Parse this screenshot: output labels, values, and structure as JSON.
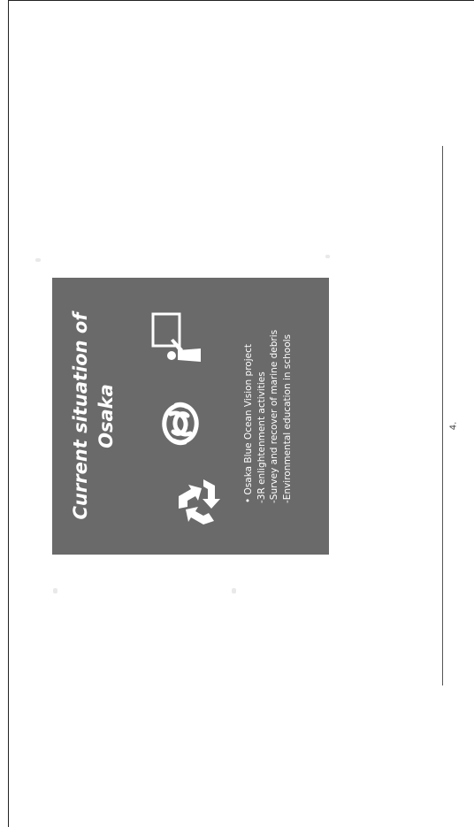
{
  "slide": {
    "title_line1": "Current situation of",
    "title_line2": "Osaka",
    "bullets": [
      "• Osaka Blue Ocean Vision project",
      "-3R enlightenment activities",
      "-Survey and recover of marine debris",
      "-Environmental education in schools"
    ],
    "icons": [
      "recycle-icon",
      "swirl-icon",
      "teacher-icon"
    ],
    "background_color": "#6a6a6a",
    "text_color": "#ffffff"
  },
  "page": {
    "number": "4."
  }
}
